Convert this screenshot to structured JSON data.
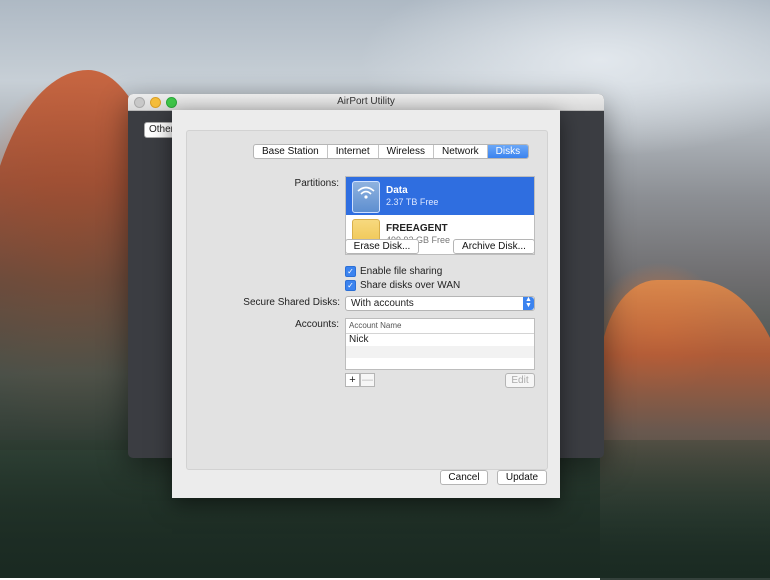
{
  "window": {
    "title": "AirPort Utility",
    "other_label": "Other"
  },
  "tabs": [
    {
      "label": "Base Station",
      "active": false
    },
    {
      "label": "Internet",
      "active": false
    },
    {
      "label": "Wireless",
      "active": false
    },
    {
      "label": "Network",
      "active": false
    },
    {
      "label": "Disks",
      "active": true
    }
  ],
  "disks": {
    "partitions_label": "Partitions:",
    "partitions": [
      {
        "name": "Data",
        "free": "2.37 TB Free",
        "icon": "wifi-disk-icon"
      },
      {
        "name": "FREEAGENT",
        "free": "499.92 GB Free",
        "icon": "external-disk-icon"
      }
    ],
    "erase_label": "Erase Disk...",
    "archive_label": "Archive Disk...",
    "enable_file_sharing": "Enable file sharing",
    "share_over_wan": "Share disks over WAN",
    "secure_label": "Secure Shared Disks:",
    "secure_value": "With accounts",
    "accounts_label": "Accounts:",
    "accounts_header": "Account Name",
    "accounts": [
      "Nick"
    ],
    "add_symbol": "+",
    "remove_symbol": "—",
    "edit_label": "Edit"
  },
  "footer": {
    "cancel_label": "Cancel",
    "update_label": "Update"
  },
  "colors": {
    "accent": "#3b83ef",
    "selection": "#2f6ee0"
  }
}
